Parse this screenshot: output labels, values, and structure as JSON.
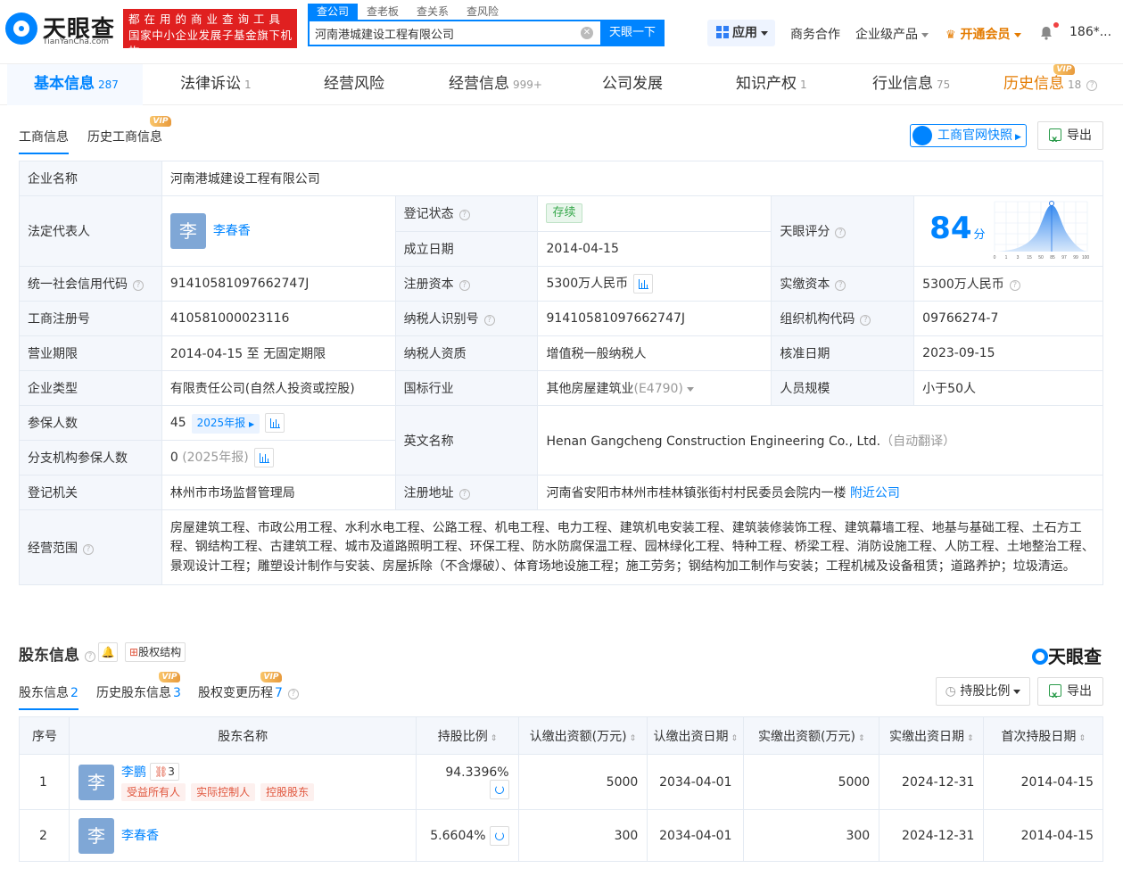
{
  "header": {
    "logo_text": "天眼查",
    "logo_sub": "TianYanCha.com",
    "slogan_line1": "都在用的商业查询工具",
    "slogan_line2": "国家中小企业发展子基金旗下机构",
    "search_tabs": [
      "查公司",
      "查老板",
      "查关系",
      "查风险"
    ],
    "search_value": "河南港城建设工程有限公司",
    "search_button": "天眼一下",
    "app_label": "应用",
    "business": "商务合作",
    "enterprise": "企业级产品",
    "vip": "开通会员",
    "user": "186*..."
  },
  "main_tabs": [
    {
      "label": "基本信息",
      "count": "287"
    },
    {
      "label": "法律诉讼",
      "count": "1"
    },
    {
      "label": "经营风险",
      "count": ""
    },
    {
      "label": "经营信息",
      "count": "999+"
    },
    {
      "label": "公司发展",
      "count": ""
    },
    {
      "label": "知识产权",
      "count": "1"
    },
    {
      "label": "行业信息",
      "count": "75"
    },
    {
      "label": "历史信息",
      "count": "18"
    }
  ],
  "vip_badge": "VIP",
  "subtabs": {
    "current": "工商信息",
    "history": "历史工商信息",
    "snapshot": "工商官网快照",
    "export": "导出"
  },
  "info": {
    "company_name_k": "企业名称",
    "company_name": "河南港城建设工程有限公司",
    "legal_rep_k": "法定代表人",
    "legal_rep_avatar": "李",
    "legal_rep": "李春香",
    "reg_status_k": "登记状态",
    "reg_status": "存续",
    "found_date_k": "成立日期",
    "found_date": "2014-04-15",
    "score_k": "天眼评分",
    "score": "84",
    "score_unit": "分",
    "credit_code_k": "统一社会信用代码",
    "credit_code": "91410581097662747J",
    "reg_capital_k": "注册资本",
    "reg_capital": "5300万人民币",
    "paid_capital_k": "实缴资本",
    "paid_capital": "5300万人民币",
    "reg_no_k": "工商注册号",
    "reg_no": "410581000023116",
    "taxpayer_id_k": "纳税人识别号",
    "taxpayer_id": "91410581097662747J",
    "org_code_k": "组织机构代码",
    "org_code": "09766274-7",
    "term_k": "营业期限",
    "term": "2014-04-15 至 无固定期限",
    "tax_quality_k": "纳税人资质",
    "tax_quality": "增值税一般纳税人",
    "approve_date_k": "核准日期",
    "approve_date": "2023-09-15",
    "type_k": "企业类型",
    "type": "有限责任公司(自然人投资或控股)",
    "industry_k": "国标行业",
    "industry": "其他房屋建筑业",
    "industry_code": "(E4790)",
    "staff_k": "人员规模",
    "staff": "小于50人",
    "insured_k": "参保人数",
    "insured": "45",
    "insured_year": "2025年报",
    "english_k": "英文名称",
    "english": "Henan Gangcheng Construction Engineering Co., Ltd.",
    "english_note": "（自动翻译）",
    "branch_insured_k": "分支机构参保人数",
    "branch_insured": "0",
    "branch_year": "(2025年报)",
    "authority_k": "登记机关",
    "authority": "林州市市场监督管理局",
    "address_k": "注册地址",
    "address": "河南省安阳市林州市桂林镇张街村村民委员会院内一楼",
    "nearby": "附近公司",
    "scope_k": "经营范围",
    "scope": "房屋建筑工程、市政公用工程、水利水电工程、公路工程、机电工程、电力工程、建筑机电安装工程、建筑装修装饰工程、建筑幕墙工程、地基与基础工程、土石方工程、钢结构工程、古建筑工程、城市及道路照明工程、环保工程、防水防腐保温工程、园林绿化工程、特种工程、桥梁工程、消防设施工程、人防工程、土地整治工程、景观设计工程；雕塑设计制作与安装、房屋拆除（不含爆破）、体育场地设施工程；施工劳务；钢结构加工制作与安装；工程机械及设备租赁；道路养护；垃圾清运。"
  },
  "score_axis": [
    "0",
    "1",
    "3",
    "15",
    "50",
    "85",
    "97",
    "99",
    "100"
  ],
  "shareholders": {
    "title": "股东信息",
    "structure": "股权结构",
    "brand": "天眼查",
    "tabs": [
      {
        "label": "股东信息",
        "count": "2"
      },
      {
        "label": "历史股东信息",
        "count": "3"
      },
      {
        "label": "股权变更历程",
        "count": "7"
      }
    ],
    "sort_label": "持股比例",
    "export": "导出",
    "columns": [
      "序号",
      "股东名称",
      "持股比例",
      "认缴出资额(万元)",
      "认缴出资日期",
      "实缴出资额(万元)",
      "实缴出资日期",
      "首次持股日期"
    ],
    "rows": [
      {
        "no": "1",
        "avatar": "李",
        "name": "李鹏",
        "related": "3",
        "roles": [
          "受益所有人",
          "实际控制人",
          "控股股东"
        ],
        "ratio": "94.3396%",
        "sub_amount": "5000",
        "sub_date": "2034-04-01",
        "paid_amount": "5000",
        "paid_date": "2024-12-31",
        "first_date": "2014-04-15"
      },
      {
        "no": "2",
        "avatar": "李",
        "name": "李春香",
        "related": "",
        "roles": [],
        "ratio": "5.6604%",
        "sub_amount": "300",
        "sub_date": "2034-04-01",
        "paid_amount": "300",
        "paid_date": "2024-12-31",
        "first_date": "2014-04-15"
      }
    ]
  },
  "colors": {
    "brand": "#0084ff",
    "vip": "#e47b00",
    "slogan_bg": "#e02020",
    "status_green": "#36a84b",
    "role_red": "#e0553c"
  }
}
